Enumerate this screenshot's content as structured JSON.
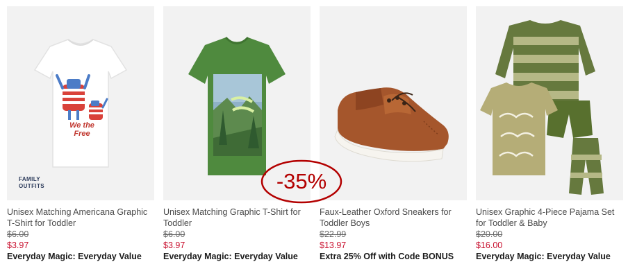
{
  "products": [
    {
      "name": "Unisex Matching Americana Graphic T-Shirt for Toddler",
      "original_price": "$6.00",
      "sale_price": "$3.97",
      "promo": "Everyday Magic: Everyday Value",
      "badge": "FAMILY\nOUTFITS",
      "graphic_text": "We the Free",
      "image_icon": "t-shirt-americana"
    },
    {
      "name": "Unisex Matching Graphic T-Shirt for Toddler",
      "original_price": "$6.00",
      "sale_price": "$3.97",
      "promo": "Everyday Magic: Everyday Value",
      "image_icon": "t-shirt-green-graphic"
    },
    {
      "name": "Faux-Leather Oxford Sneakers for Toddler Boys",
      "original_price": "$22.99",
      "sale_price": "$13.97",
      "promo": "Extra 25% Off with Code BONUS",
      "image_icon": "brown-sneaker"
    },
    {
      "name": "Unisex Graphic 4-Piece Pajama Set for Toddler & Baby",
      "original_price": "$20.00",
      "sale_price": "$16.00",
      "promo": "Everyday Magic: Everyday Value",
      "image_icon": "dino-pajama-set"
    }
  ],
  "discount_stamp": "-35%",
  "colors": {
    "sale": "#c8102e",
    "stamp": "#b30000",
    "image_bg": "#f2f2f2"
  }
}
